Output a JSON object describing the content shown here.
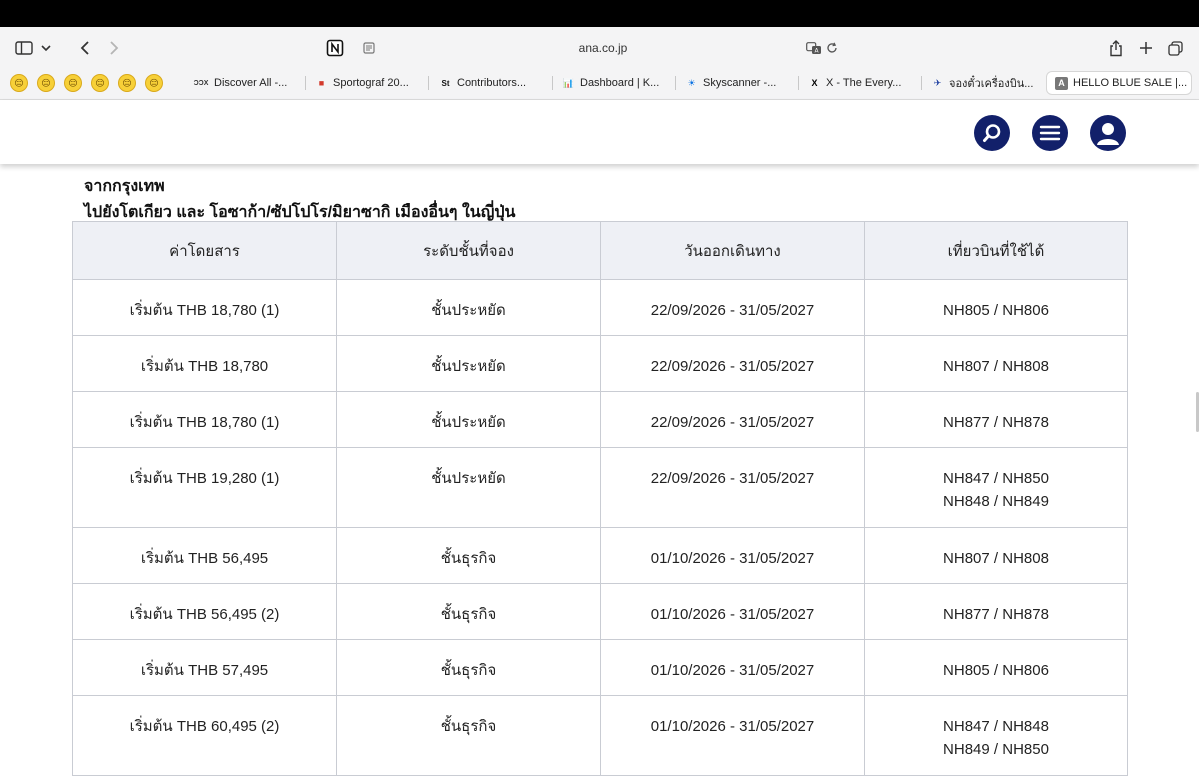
{
  "browser": {
    "address": "ana.co.jp",
    "favorites_glyph": "😑",
    "tabs": [
      {
        "icon": "ƆƆX",
        "label": "Discover All -...",
        "icon_color": "#333333"
      },
      {
        "icon": "■",
        "label": "Sportograf 20...",
        "icon_color": "#d33a2c"
      },
      {
        "icon": "St",
        "label": "Contributors...",
        "icon_color": "#111111"
      },
      {
        "icon": "📊",
        "label": "Dashboard | K...",
        "icon_color": "#e08a00"
      },
      {
        "icon": "☀",
        "label": "Skyscanner -...",
        "icon_color": "#0770e3"
      },
      {
        "icon": "X",
        "label": "X - The Every...",
        "icon_color": "#000000"
      },
      {
        "icon": "✈",
        "label": "จองตั๋วเครื่องบิน...",
        "icon_color": "#1d3fa0"
      },
      {
        "icon": "A",
        "label": "HELLO BLUE SALE |...",
        "icon_color": "#555555"
      }
    ]
  },
  "page": {
    "origin": "จากกรุงเทพ",
    "destination": "ไปยังโตเกียว และ โอซาก้า/ซัปโปโร/มิยาซากิ เมืองอื่นๆ ในญี่ปุ่น"
  },
  "table": {
    "headers": [
      "ค่าโดยสาร",
      "ระดับชั้นที่จอง",
      "วันออกเดินทาง",
      "เที่ยวบินที่ใช้ได้"
    ],
    "rows": [
      {
        "fare": "เริ่มต้น THB 18,780 (1)",
        "class": "ชั้นประหยัด",
        "dates": "22/09/2026 - 31/05/2027",
        "flight1": "NH805 / NH806",
        "flight2": ""
      },
      {
        "fare": "เริ่มต้น THB 18,780",
        "class": "ชั้นประหยัด",
        "dates": "22/09/2026 - 31/05/2027",
        "flight1": "NH807 / NH808",
        "flight2": ""
      },
      {
        "fare": "เริ่มต้น THB 18,780 (1)",
        "class": "ชั้นประหยัด",
        "dates": "22/09/2026 - 31/05/2027",
        "flight1": "NH877 / NH878",
        "flight2": ""
      },
      {
        "fare": "เริ่มต้น THB 19,280 (1)",
        "class": "ชั้นประหยัด",
        "dates": "22/09/2026 - 31/05/2027",
        "flight1": "NH847 / NH850",
        "flight2": "NH848 / NH849"
      },
      {
        "fare": "เริ่มต้น THB 56,495",
        "class": "ชั้นธุรกิจ",
        "dates": "01/10/2026 - 31/05/2027",
        "flight1": "NH807 / NH808",
        "flight2": ""
      },
      {
        "fare": "เริ่มต้น THB 56,495 (2)",
        "class": "ชั้นธุรกิจ",
        "dates": "01/10/2026 - 31/05/2027",
        "flight1": "NH877 / NH878",
        "flight2": ""
      },
      {
        "fare": "เริ่มต้น THB 57,495",
        "class": "ชั้นธุรกิจ",
        "dates": "01/10/2026 - 31/05/2027",
        "flight1": "NH805 / NH806",
        "flight2": ""
      },
      {
        "fare": "เริ่มต้น THB 60,495 (2)",
        "class": "ชั้นธุรกิจ",
        "dates": "01/10/2026 - 31/05/2027",
        "flight1": "NH847 / NH848",
        "flight2": "NH849 / NH850"
      }
    ]
  },
  "colors": {
    "brand_navy": "#12206a",
    "table_header_bg": "#eef0f5",
    "table_border": "#c9ccd3"
  }
}
